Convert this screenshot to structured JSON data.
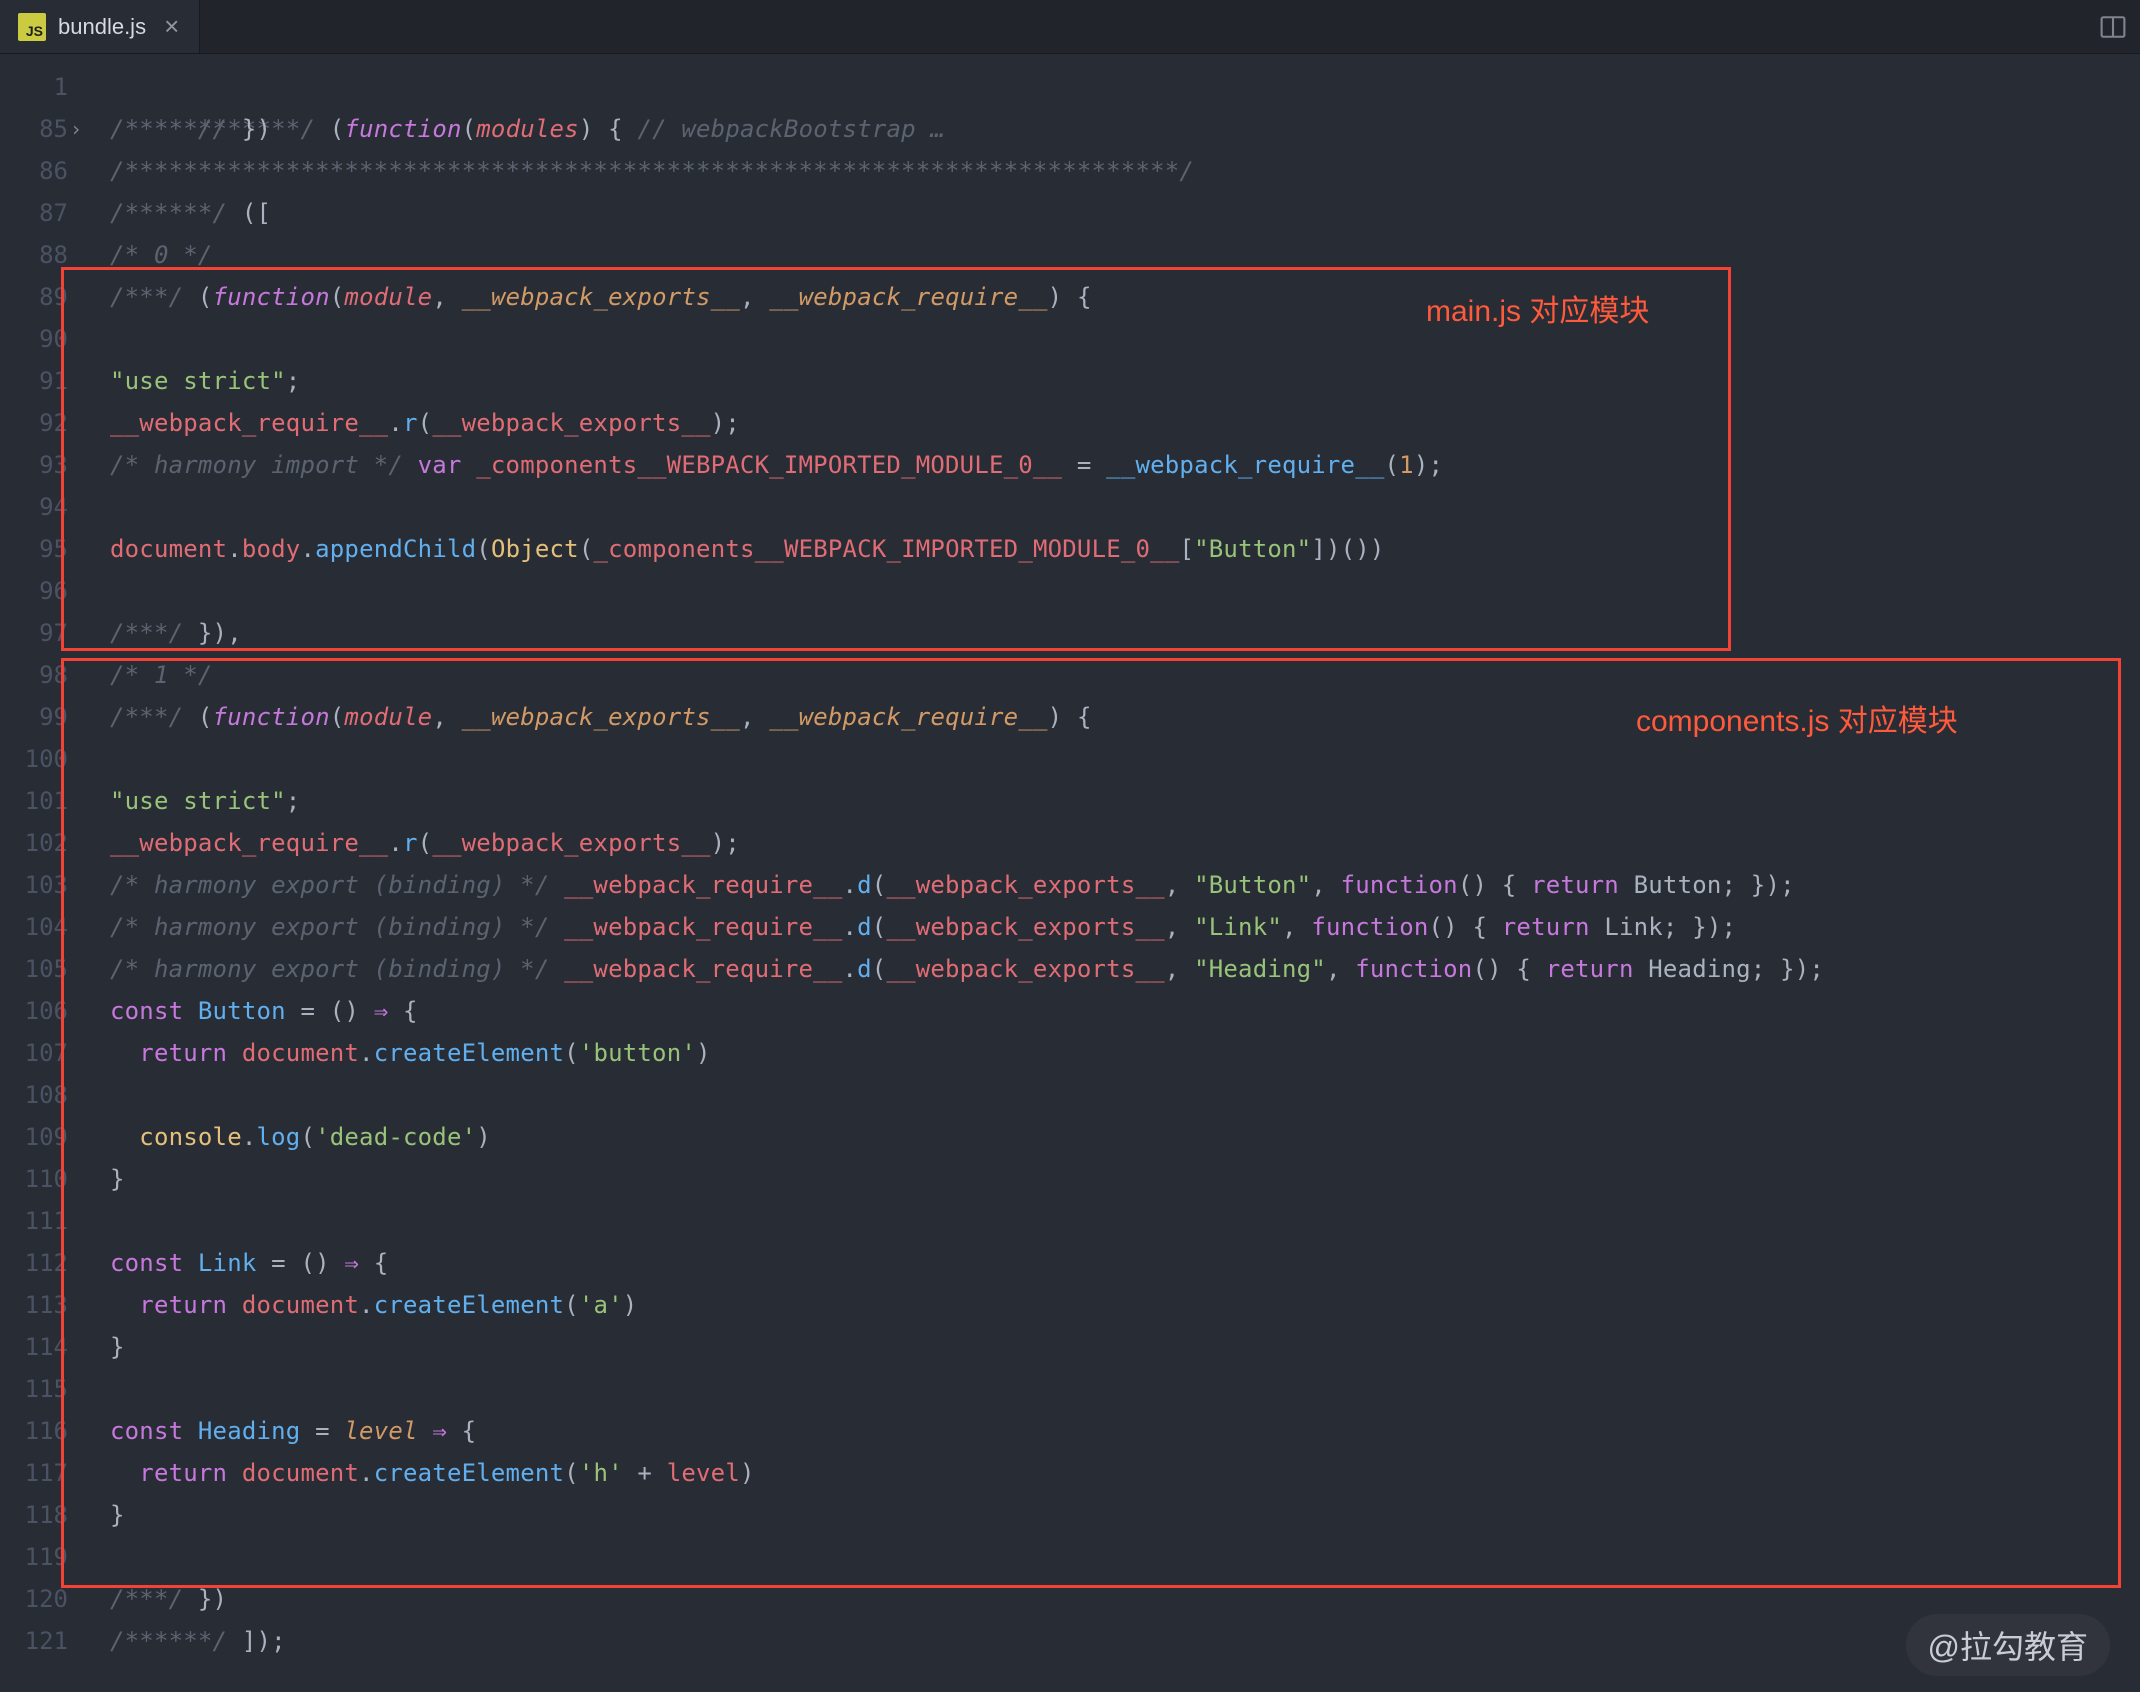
{
  "tab": {
    "icon_text": "JS",
    "filename": "bundle.js",
    "close_glyph": "×"
  },
  "line_numbers": [
    "1",
    "85",
    "86",
    "87",
    "88",
    "89",
    "90",
    "91",
    "92",
    "93",
    "94",
    "95",
    "96",
    "97",
    "98",
    "99",
    "100",
    "101",
    "102",
    "103",
    "104",
    "105",
    "106",
    "107",
    "108",
    "109",
    "110",
    "111",
    "112",
    "113",
    "114",
    "115",
    "116",
    "117",
    "118",
    "119",
    "120",
    "121"
  ],
  "code": {
    "l1_a": "/******/",
    "l1_b": " (",
    "l1_c": "function",
    "l1_d": "(",
    "l1_e": "modules",
    "l1_f": ") { ",
    "l1_g": "// webpackBootstrap",
    "l1_h": " …",
    "l85": "/******/",
    "l85b": " })",
    "l86": "/************************************************************************/",
    "l87": "/******/",
    "l87b": " ([",
    "l88": "/* 0 */",
    "l89a": "/***/",
    "l89b": " (",
    "l89c": "function",
    "l89d": "(",
    "l89e": "module",
    "l89f": ", ",
    "l89g": "__webpack_exports__",
    "l89h": ", ",
    "l89i": "__webpack_require__",
    "l89j": ") {",
    "l91": "\"use strict\"",
    "l91b": ";",
    "l92a": "__webpack_require__",
    "l92b": ".",
    "l92c": "r",
    "l92d": "(",
    "l92e": "__webpack_exports__",
    "l92f": ");",
    "l93a": "/* harmony import */",
    "l93b": " var",
    "l93c": " _components__WEBPACK_IMPORTED_MODULE_0__",
    "l93d": " = ",
    "l93e": "__webpack_require__",
    "l93f": "(",
    "l93g": "1",
    "l93h": ");",
    "l95a": "document",
    "l95b": ".",
    "l95c": "body",
    "l95d": ".",
    "l95e": "appendChild",
    "l95f": "(",
    "l95g": "Object",
    "l95h": "(",
    "l95i": "_components__WEBPACK_IMPORTED_MODULE_0__",
    "l95j": "[",
    "l95k": "\"Button\"",
    "l95l": "])())",
    "l97a": "/***/",
    "l97b": " }),",
    "l98": "/* 1 */",
    "l99a": "/***/",
    "l99b": " (",
    "l99c": "function",
    "l99d": "(",
    "l99e": "module",
    "l99f": ", ",
    "l99g": "__webpack_exports__",
    "l99h": ", ",
    "l99i": "__webpack_require__",
    "l99j": ") {",
    "l101": "\"use strict\"",
    "l101b": ";",
    "l102a": "__webpack_require__",
    "l102b": ".",
    "l102c": "r",
    "l102d": "(",
    "l102e": "__webpack_exports__",
    "l102f": ");",
    "l103a": "/* harmony export (binding) */",
    "l103b": " __webpack_require__",
    "l103c": ".",
    "l103d": "d",
    "l103e": "(",
    "l103f": "__webpack_exports__",
    "l103g": ", ",
    "l103h": "\"Button\"",
    "l103i": ", ",
    "l103j": "function",
    "l103k": "() { ",
    "l103l": "return",
    "l103m": " Button; });",
    "l104a": "/* harmony export (binding) */",
    "l104b": " __webpack_require__",
    "l104c": ".",
    "l104d": "d",
    "l104e": "(",
    "l104f": "__webpack_exports__",
    "l104g": ", ",
    "l104h": "\"Link\"",
    "l104i": ", ",
    "l104j": "function",
    "l104k": "() { ",
    "l104l": "return",
    "l104m": " Link; });",
    "l105a": "/* harmony export (binding) */",
    "l105b": " __webpack_require__",
    "l105c": ".",
    "l105d": "d",
    "l105e": "(",
    "l105f": "__webpack_exports__",
    "l105g": ", ",
    "l105h": "\"Heading\"",
    "l105i": ", ",
    "l105j": "function",
    "l105k": "() { ",
    "l105l": "return",
    "l105m": " Heading; });",
    "l106a": "const",
    "l106b": " Button",
    "l106c": " = () ",
    "l106d": "⇒",
    "l106e": " {",
    "l107a": "  return",
    "l107b": " document",
    "l107c": ".",
    "l107d": "createElement",
    "l107e": "(",
    "l107f": "'button'",
    "l107g": ")",
    "l109a": "  console",
    "l109b": ".",
    "l109c": "log",
    "l109d": "(",
    "l109e": "'dead-code'",
    "l109f": ")",
    "l110": "}",
    "l112a": "const",
    "l112b": " Link",
    "l112c": " = () ",
    "l112d": "⇒",
    "l112e": " {",
    "l113a": "  return",
    "l113b": " document",
    "l113c": ".",
    "l113d": "createElement",
    "l113e": "(",
    "l113f": "'a'",
    "l113g": ")",
    "l114": "}",
    "l116a": "const",
    "l116b": " Heading",
    "l116c": " = ",
    "l116d": "level",
    "l116e": " ",
    "l116f": "⇒",
    "l116g": " {",
    "l117a": "  return",
    "l117b": " document",
    "l117c": ".",
    "l117d": "createElement",
    "l117e": "(",
    "l117f": "'h'",
    "l117g": " + ",
    "l117h": "level",
    "l117i": ")",
    "l118": "}",
    "l120a": "/***/",
    "l120b": " })",
    "l121a": "/******/",
    "l121b": " ]);"
  },
  "annotations": {
    "box1_label": "main.js 对应模块",
    "box2_label": "components.js 对应模块"
  },
  "watermark": "@拉勾教育"
}
